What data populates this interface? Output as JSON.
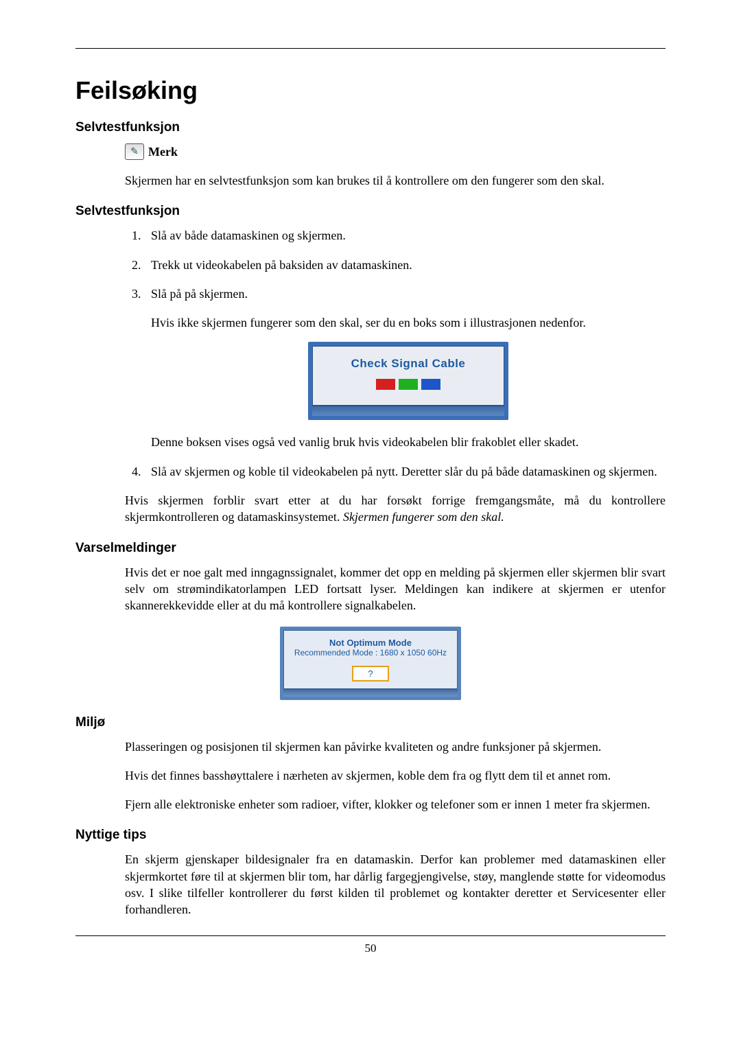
{
  "title": "Feilsøking",
  "page_number": "50",
  "note": {
    "icon_glyph": "✎",
    "label": "Merk",
    "text": "Skjermen har en selvtestfunksjon som kan brukes til å kontrollere om den fungerer som den skal."
  },
  "sections": {
    "selftest1_heading": "Selvtestfunksjon",
    "selftest2_heading": "Selvtestfunksjon",
    "warnings_heading": "Varselmeldinger",
    "env_heading": "Miljø",
    "tips_heading": "Nyttige tips"
  },
  "steps": {
    "s1": "Slå av både datamaskinen og skjermen.",
    "s2": "Trekk ut videokabelen på baksiden av datamaskinen.",
    "s3": "Slå på på skjermen.",
    "s3_sub": "Hvis ikke skjermen fungerer som den skal, ser du en boks som i illustrasjonen nedenfor.",
    "s3_after": "Denne boksen vises også ved vanlig bruk hvis videokabelen blir frakoblet eller skadet.",
    "s4": "Slå av skjermen og koble til videokabelen på nytt. Deretter slår du på både datamaskinen og skjermen."
  },
  "selftest_footer": {
    "text": "Hvis skjermen forblir svart etter at du har forsøkt forrige fremgangsmåte, må du kontrollere skjermkontrolleren og datamaskinsystemet. ",
    "italic": "Skjermen fungerer som den skal."
  },
  "figure1": {
    "label": "Check Signal Cable"
  },
  "figure2": {
    "line1": "Not Optimum Mode",
    "line2": "Recommended Mode : 1680 x  1050 60Hz",
    "box": "?"
  },
  "warnings_text": "Hvis det er noe galt med inngagnssignalet, kommer det opp en melding på skjermen eller skjermen blir svart selv om strømindikatorlampen LED fortsatt lyser. Meldingen kan indikere at skjermen er utenfor skannerekkevidde eller at du må kontrollere signalkabelen.",
  "env": {
    "p1": "Plasseringen og posisjonen til skjermen kan påvirke kvaliteten og andre funksjoner på skjermen.",
    "p2": "Hvis det finnes basshøyttalere i nærheten av skjermen, koble dem fra og flytt dem til et annet rom.",
    "p3": "Fjern alle elektroniske enheter som radioer, vifter, klokker og telefoner som er innen 1 meter fra skjermen."
  },
  "tips_text": "En skjerm gjenskaper bildesignaler fra en datamaskin. Derfor kan problemer med datamaskinen eller skjermkortet føre til at skjermen blir tom, har dårlig fargegjengivelse, støy, manglende støtte for videomodus osv. I slike tilfeller kontrollerer du først kilden til problemet og kontakter deretter et Servicesenter eller forhandleren."
}
